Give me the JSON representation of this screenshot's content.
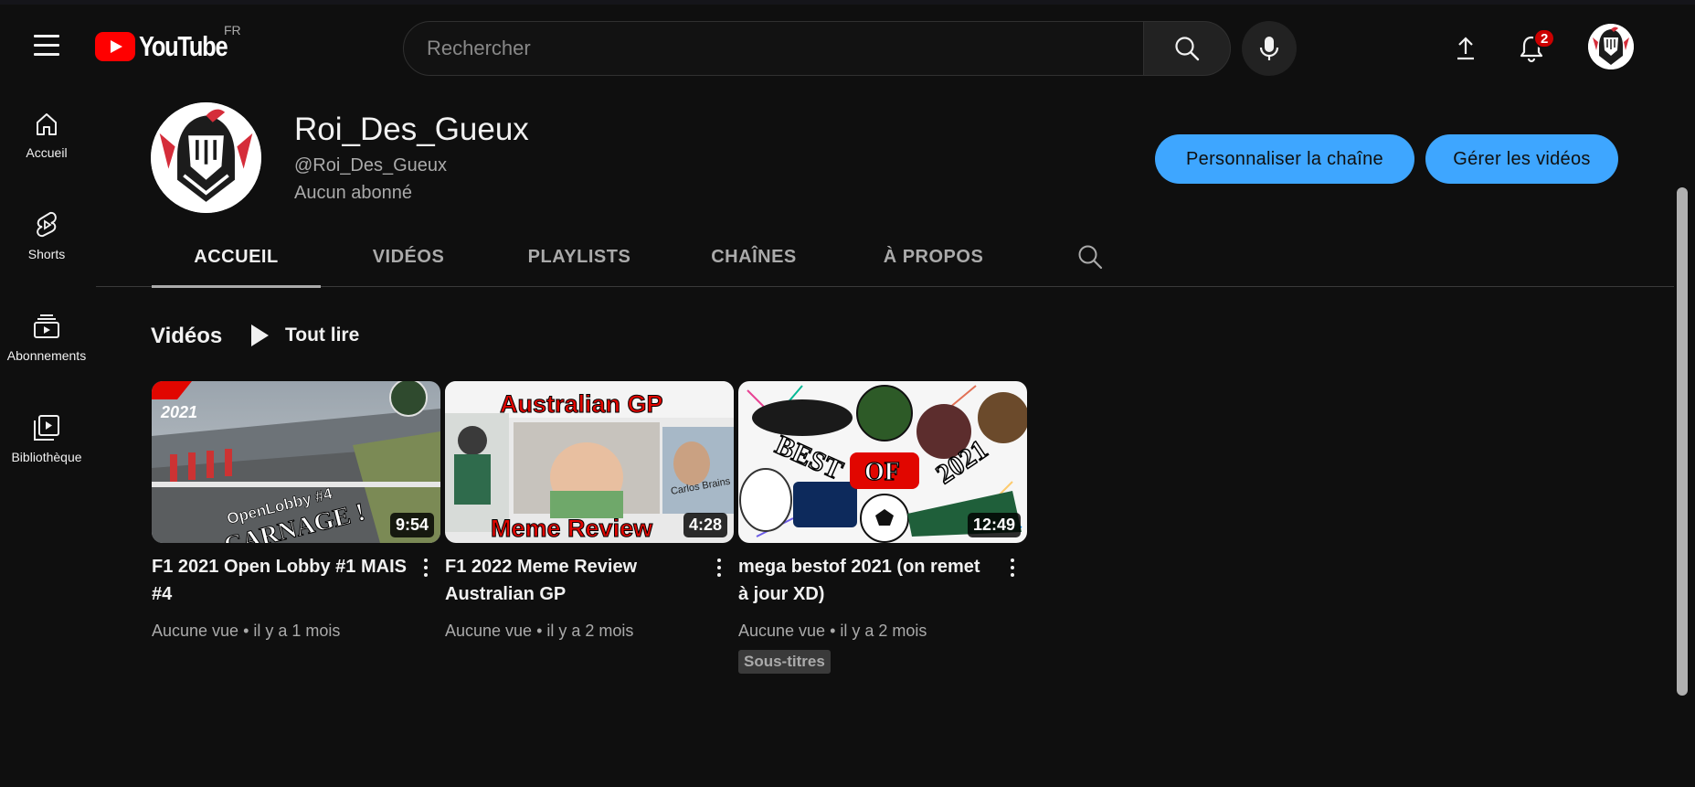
{
  "header": {
    "logo_text": "YouTube",
    "region": "FR",
    "search_placeholder": "Rechercher",
    "notification_count": "2"
  },
  "sidebar": {
    "items": [
      {
        "label": "Accueil",
        "icon": "home-icon"
      },
      {
        "label": "Shorts",
        "icon": "shorts-icon"
      },
      {
        "label": "Abonnements",
        "icon": "subscriptions-icon"
      },
      {
        "label": "Bibliothèque",
        "icon": "library-icon"
      }
    ]
  },
  "channel": {
    "name": "Roi_Des_Gueux",
    "handle": "@Roi_Des_Gueux",
    "subscribers": "Aucun abonné",
    "customize_label": "Personnaliser la chaîne",
    "manage_label": "Gérer les vidéos"
  },
  "tabs": [
    "ACCUEIL",
    "VIDÉOS",
    "PLAYLISTS",
    "CHAÎNES",
    "À PROPOS"
  ],
  "section": {
    "title": "Vidéos",
    "play_all_label": "Tout lire"
  },
  "videos": [
    {
      "title": "F1 2021 Open Lobby #1 MAIS #4",
      "duration": "9:54",
      "views": "Aucune vue",
      "age": "il y a 1 mois",
      "thumb_text": [
        "2021",
        "OpenLobby #4",
        "CARNAGE !"
      ]
    },
    {
      "title": "F1 2022 Meme Review Australian GP",
      "duration": "4:28",
      "views": "Aucune vue",
      "age": "il y a 2 mois",
      "thumb_text": [
        "Australian GP",
        "Meme Review",
        "Carlos Brains"
      ]
    },
    {
      "title": "mega bestof 2021 (on remet à jour XD)",
      "duration": "12:49",
      "views": "Aucune vue",
      "age": "il y a 2 mois",
      "badge": "Sous-titres",
      "thumb_text": [
        "BEST",
        "OF",
        "2021"
      ]
    }
  ],
  "colors": {
    "background": "#0f0f0f",
    "accent_button": "#3ea6ff",
    "youtube_red": "#ff0000",
    "badge_red": "#cc0000"
  }
}
